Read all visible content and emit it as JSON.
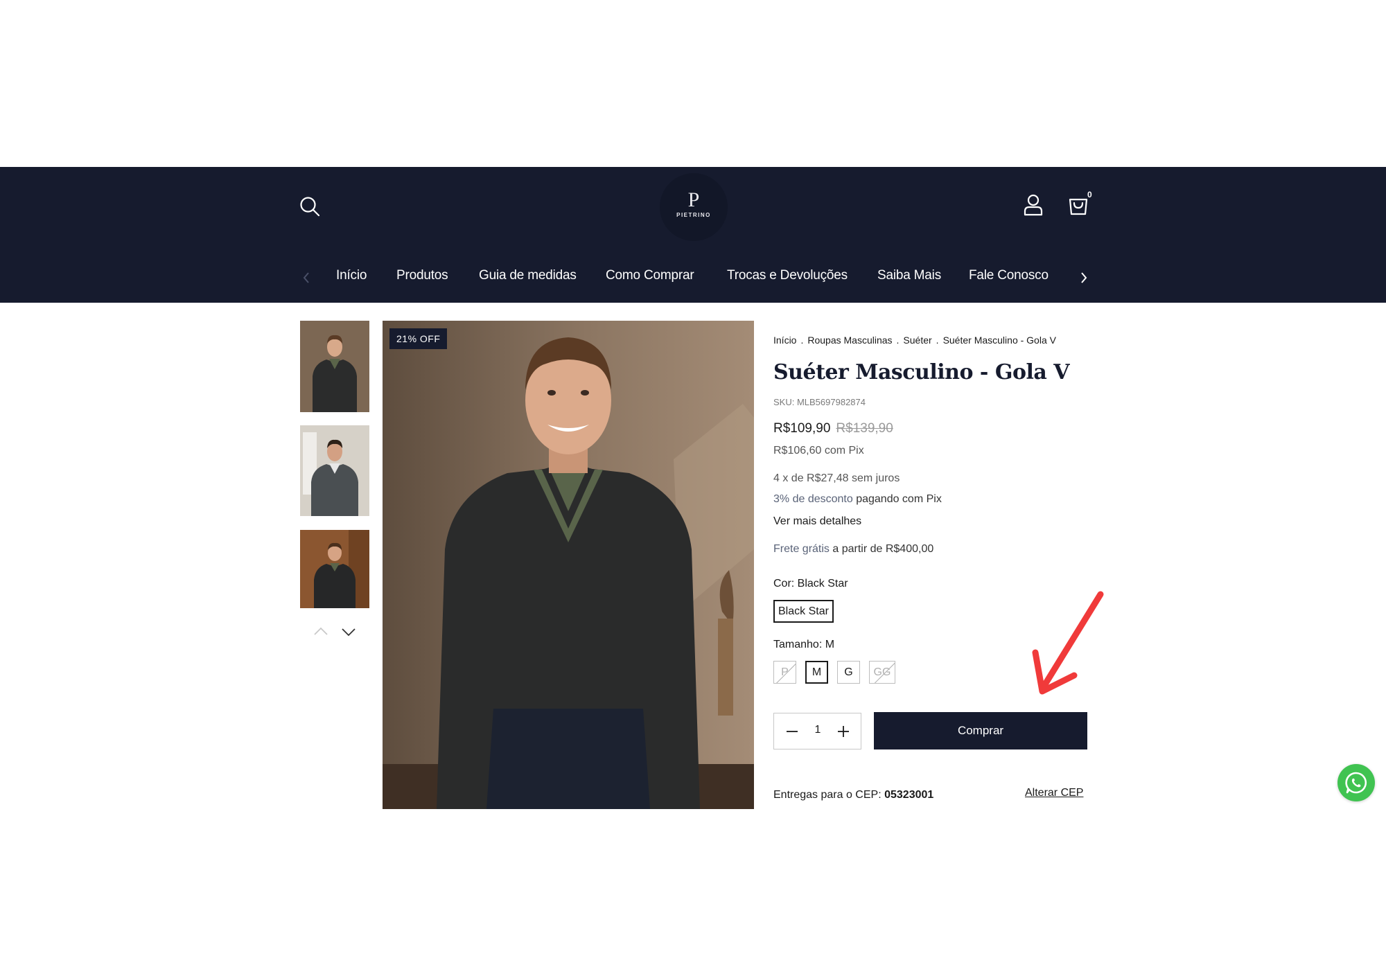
{
  "header": {
    "brand_initial": "P",
    "brand_name": "PIETRINO",
    "cart_count": "0"
  },
  "nav": {
    "items": [
      "Início",
      "Produtos",
      "Guia de medidas",
      "Como Comprar",
      "Trocas e Devoluções",
      "Saiba Mais",
      "Fale Conosco"
    ]
  },
  "gallery": {
    "badge": "21% OFF"
  },
  "breadcrumb": [
    "Início",
    "Roupas Masculinas",
    "Suéter",
    "Suéter Masculino - Gola V"
  ],
  "product": {
    "title": "Suéter Masculino - Gola V",
    "sku": "SKU: MLB5697982874",
    "price": "R$109,90",
    "price_old": "R$139,90",
    "pix_price": "R$106,60 com Pix",
    "installments": "4 x de R$27,48 sem juros",
    "pix_discount_link": "3% de desconto",
    "pix_discount_text": " pagando com Pix",
    "more_details": "Ver mais detalhes",
    "shipping_link": "Frete grátis",
    "shipping_text": " a partir de R$400,00"
  },
  "variants": {
    "color_label": "Cor: Black Star",
    "color_option": "Black Star",
    "size_label": "Tamanho: M",
    "sizes": [
      {
        "label": "P",
        "state": "unavailable"
      },
      {
        "label": "M",
        "state": "selected"
      },
      {
        "label": "G",
        "state": "available"
      },
      {
        "label": "GG",
        "state": "unavailable"
      }
    ]
  },
  "purchase": {
    "quantity": "1",
    "buy_label": "Comprar"
  },
  "delivery": {
    "label": "Entregas para o CEP: ",
    "cep": "05323001",
    "change_label": "Alterar CEP"
  },
  "colors": {
    "navy": "#161b2e",
    "annotation_red": "#f03a3a",
    "whatsapp_green": "#40c351"
  }
}
